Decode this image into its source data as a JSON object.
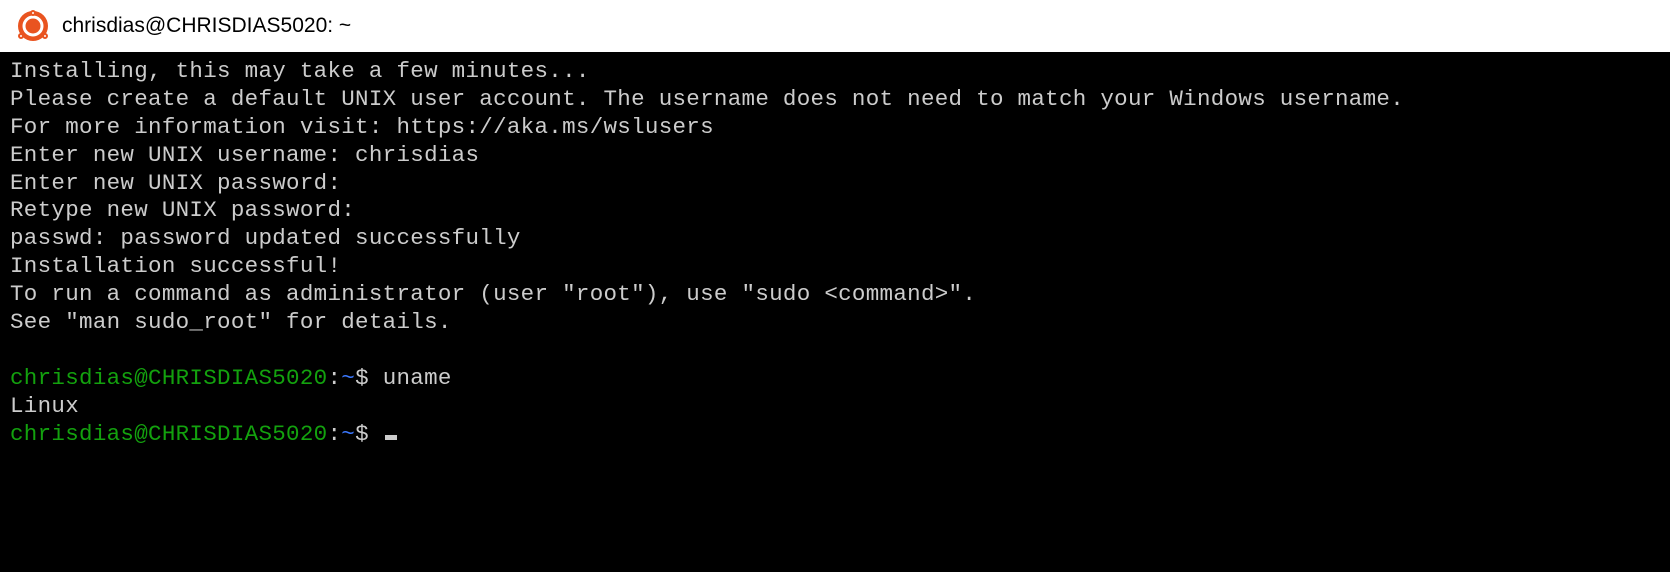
{
  "window": {
    "title": "chrisdias@CHRISDIAS5020: ~"
  },
  "terminal": {
    "lines": [
      "Installing, this may take a few minutes...",
      "Please create a default UNIX user account. The username does not need to match your Windows username.",
      "For more information visit: https://aka.ms/wslusers",
      "Enter new UNIX username: chrisdias",
      "Enter new UNIX password:",
      "Retype new UNIX password:",
      "passwd: password updated successfully",
      "Installation successful!",
      "To run a command as administrator (user \"root\"), use \"sudo <command>\".",
      "See \"man sudo_root\" for details.",
      ""
    ],
    "prompt1": {
      "userhost": "chrisdias@CHRISDIAS5020",
      "colon": ":",
      "path": "~",
      "dollar": "$ ",
      "command": "uname"
    },
    "output1": "Linux",
    "prompt2": {
      "userhost": "chrisdias@CHRISDIAS5020",
      "colon": ":",
      "path": "~",
      "dollar": "$ "
    }
  }
}
